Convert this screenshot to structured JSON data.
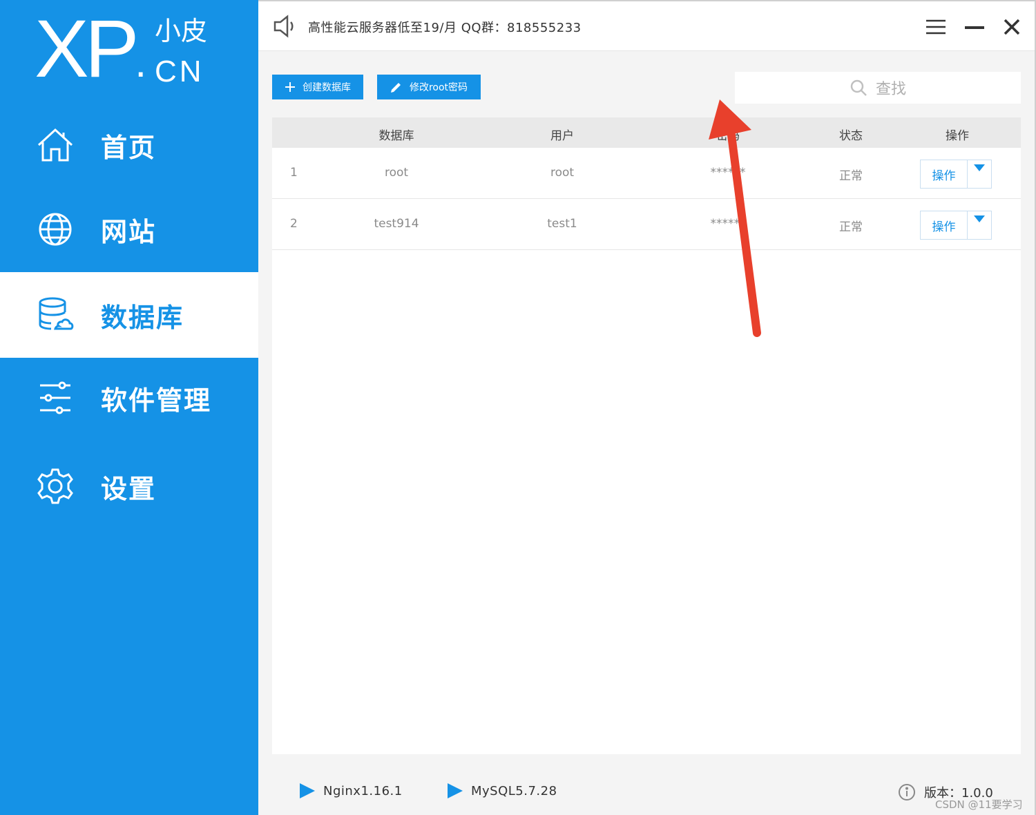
{
  "sidebar": {
    "logo": {
      "main": "XP",
      "dot": ".",
      "top": "小皮",
      "bottom": "CN"
    },
    "items": [
      {
        "label": "首页",
        "icon": "home-icon",
        "active": false
      },
      {
        "label": "网站",
        "icon": "globe-icon",
        "active": false
      },
      {
        "label": "数据库",
        "icon": "database-icon",
        "active": true
      },
      {
        "label": "软件管理",
        "icon": "sliders-icon",
        "active": false
      },
      {
        "label": "设置",
        "icon": "gear-icon",
        "active": false
      }
    ]
  },
  "topbar": {
    "notice": "高性能云服务器低至19/月  QQ群：818555233",
    "icons": [
      "speaker-icon",
      "menu-icon",
      "minimize-icon",
      "close-icon"
    ]
  },
  "toolbar": {
    "create_label": "创建数据库",
    "edit_label": "修改root密码",
    "search_placeholder": "查找"
  },
  "table": {
    "headers": [
      "数据库",
      "用户",
      "密码",
      "状态",
      "操作"
    ],
    "rows": [
      {
        "index": "1",
        "database": "root",
        "user": "root",
        "password": "******",
        "status": "正常",
        "action": "操作"
      },
      {
        "index": "2",
        "database": "test914",
        "user": "test1",
        "password": "******",
        "status": "正常",
        "action": "操作"
      }
    ]
  },
  "statusbar": {
    "services": [
      "Nginx1.16.1",
      "MySQL5.7.28"
    ],
    "version": "版本：1.0.0",
    "watermark": "CSDN @11要学习"
  },
  "colors": {
    "accent": "#1592e6",
    "arrow": "#e8402c",
    "background": "#f4f4f4"
  }
}
